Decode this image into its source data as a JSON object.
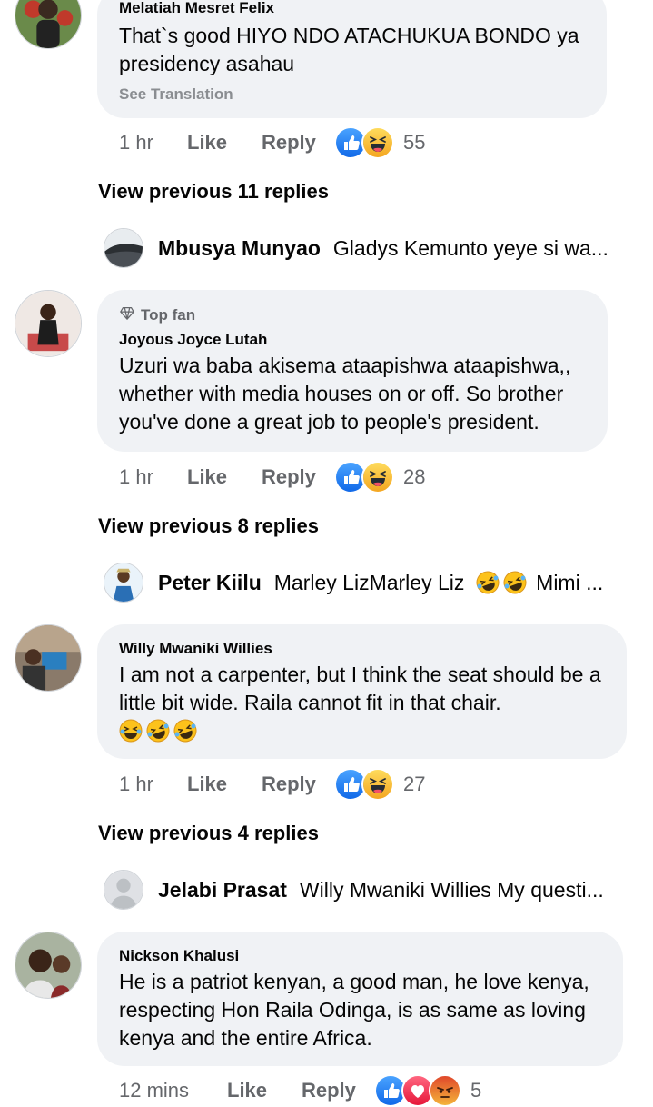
{
  "comments": [
    {
      "author": "Melatiah Mesret Felix",
      "text": "That`s good HIYO NDO ATACHUKUA BONDO ya presidency asahau",
      "see_translation": "See Translation",
      "time": "1 hr",
      "like": "Like",
      "reply": "Reply",
      "reactions": [
        "like-icon",
        "haha-icon"
      ],
      "reaction_count": "55",
      "view_previous": "View previous 11 replies",
      "latest_reply": {
        "name": "Mbusya Munyao",
        "text": "Gladys Kemunto yeye si wa..."
      }
    },
    {
      "badge": "Top fan",
      "author": "Joyous Joyce Lutah",
      "text": "Uzuri wa baba akisema ataapishwa ataapishwa,, whether with media houses on or off. So brother you've done a great job to people's president.",
      "time": "1 hr",
      "like": "Like",
      "reply": "Reply",
      "reactions": [
        "like-icon",
        "haha-icon"
      ],
      "reaction_count": "28",
      "view_previous": "View previous 8 replies",
      "latest_reply": {
        "name": "Peter Kiilu",
        "text_before": "Marley LizMarley Liz",
        "text_after": "Mimi ..."
      }
    },
    {
      "author": "Willy Mwaniki Willies",
      "text": "I am not a carpenter, but I think the seat should be a little bit wide. Raila cannot fit in that chair.",
      "time": "1 hr",
      "like": "Like",
      "reply": "Reply",
      "reactions": [
        "like-icon",
        "haha-icon"
      ],
      "reaction_count": "27",
      "view_previous": "View previous 4 replies",
      "latest_reply": {
        "name": "Jelabi Prasat",
        "text": "Willy Mwaniki Willies My questi..."
      }
    },
    {
      "author": "Nickson Khalusi",
      "text": "He is a patriot kenyan, a good man, he love kenya, respecting Hon Raila Odinga, is as same as loving kenya and the entire Africa.",
      "time": "12 mins",
      "like": "Like",
      "reply": "Reply",
      "reactions": [
        "like-icon",
        "love-icon",
        "angry-icon"
      ],
      "reaction_count": "5"
    }
  ],
  "colors": {
    "bubble": "#f0f2f5",
    "meta_text": "#65676b",
    "like_blue": "#1877f2",
    "love_red": "#f33e58",
    "haha_yellow": "#f7b125",
    "angry_orange": "#e9710f"
  }
}
